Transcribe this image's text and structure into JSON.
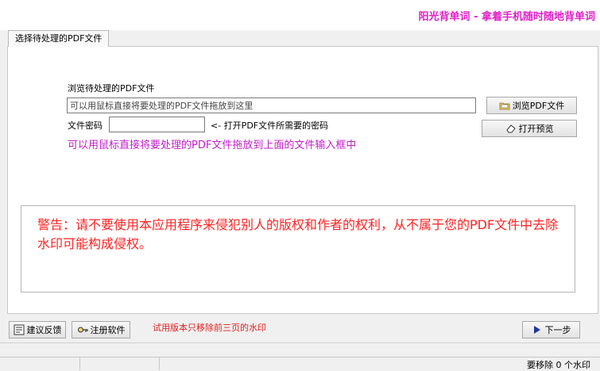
{
  "banner": {
    "title": "阳光背单词 - 拿着手机随时随地背单词",
    "color": "#e020c8"
  },
  "tab": {
    "label": "选择待处理的PDF文件"
  },
  "form": {
    "browse_label": "浏览待处理的PDF文件",
    "file_input_value": "可以用鼠标直接将要处理的PDF文件拖放到这里",
    "password_label": "文件密码",
    "password_value": "",
    "password_hint": "<- 打开PDF文件所需要的密码",
    "browse_button": "浏览PDF文件",
    "preview_button": "打开预览",
    "drag_hint": "可以用鼠标直接将要处理的PDF文件拖放到上面的文件输入框中"
  },
  "warning": {
    "text": "警告：请不要使用本应用程序来侵犯别人的版权和作者的权利，从不属于您的PDF文件中去除水印可能构成侵权。",
    "color": "#ff2222"
  },
  "bottom": {
    "feedback_button": "建议反馈",
    "register_button": "注册软件",
    "trial_note": "试用版本只移除前三页的水印",
    "next_button": "下一步"
  },
  "status": {
    "text": "要移除 0 个水印"
  }
}
